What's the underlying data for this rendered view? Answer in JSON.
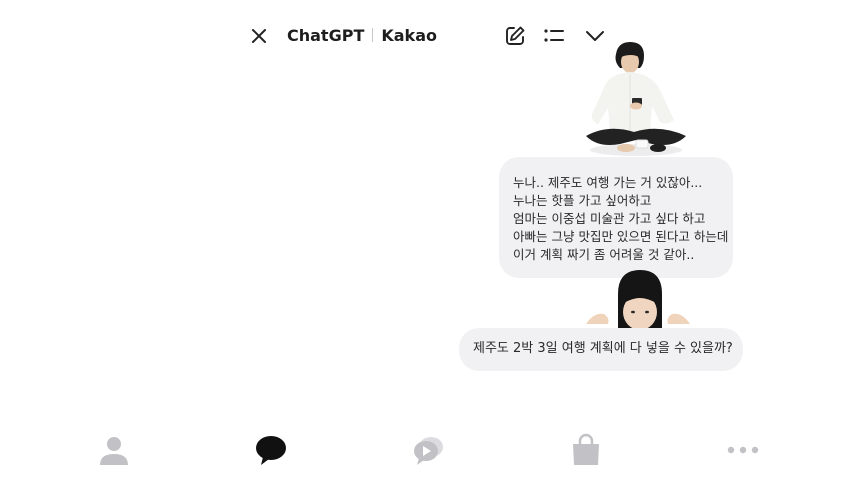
{
  "header": {
    "brand_left": "ChatGPT",
    "brand_right": "Kakao",
    "icons": {
      "close": "close-icon",
      "edit": "compose-icon",
      "list": "list-icon",
      "more": "chevron-down-icon"
    }
  },
  "messages": [
    {
      "lines": [
        "누나.. 제주도 여행 가는 거 있잖아...",
        "누나는 핫플 가고 싶어하고",
        "엄마는 이중섭 미술관 가고 싶다 하고",
        "아빠는 그냥 맛집만 있으면 된다고 하는데",
        "이거 계획 짜기 좀 어려울 것 같아.."
      ]
    },
    {
      "text": "제주도 2박 3일 여행 계획에 다 넣을 수 있을까?"
    }
  ],
  "bottom_nav": {
    "items": [
      {
        "icon": "person-icon",
        "active": false
      },
      {
        "icon": "chat-bubble-icon",
        "active": true
      },
      {
        "icon": "open-chat-icon",
        "active": false
      },
      {
        "icon": "shopping-bag-icon",
        "active": false
      },
      {
        "icon": "more-dots-icon",
        "active": false
      }
    ]
  },
  "colors": {
    "background": "#ffffff",
    "bubble": "#f1f1f3",
    "text": "#2a2a2a",
    "nav_active": "#111111",
    "nav_inactive": "#c2c2c6"
  }
}
